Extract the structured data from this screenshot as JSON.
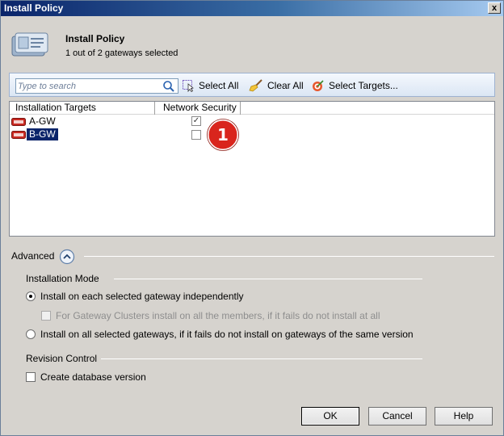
{
  "window": {
    "title": "Install Policy",
    "close_glyph": "x"
  },
  "header": {
    "title": "Install Policy",
    "subtitle": "1 out of 2 gateways selected",
    "icon": "policy-install-icon"
  },
  "toolbar": {
    "search_placeholder": "Type to search",
    "select_all": "Select All",
    "clear_all": "Clear All",
    "select_targets": "Select Targets..."
  },
  "table": {
    "columns": [
      "Installation Targets",
      "Network Security"
    ],
    "rows": [
      {
        "name": "A-GW",
        "network_security": true,
        "selected": false
      },
      {
        "name": "B-GW",
        "network_security": false,
        "selected": true
      }
    ]
  },
  "callout": {
    "number": "1",
    "color": "#d9251d"
  },
  "advanced": {
    "label": "Advanced",
    "installation_mode": {
      "title": "Installation Mode",
      "option_independent": "Install on each selected gateway independently",
      "cluster_option": "For Gateway Clusters install on all the members, if it fails do not install at all",
      "option_all": "Install on all selected gateways, if it fails do not install on gateways of the same version"
    },
    "revision_control": {
      "title": "Revision Control",
      "create_db_version": "Create database version"
    }
  },
  "buttons": {
    "ok": "OK",
    "cancel": "Cancel",
    "help": "Help"
  }
}
